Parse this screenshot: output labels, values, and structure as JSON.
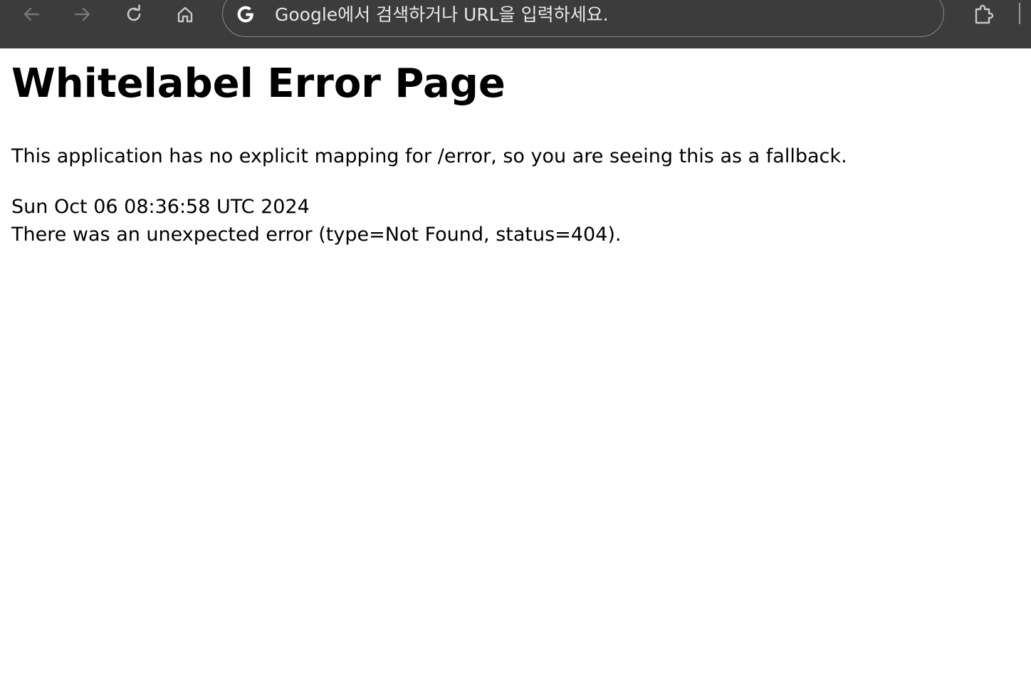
{
  "browser": {
    "omnibox_placeholder": "Google에서 검색하거나 URL을 입력하세요.",
    "icons": [
      "back-arrow-icon",
      "forward-arrow-icon",
      "reload-icon",
      "home-icon",
      "google-g-icon",
      "extensions-icon"
    ],
    "colors": {
      "toolbar": "#3c3c3c",
      "icon": "#c7c7c7",
      "icon_disabled": "#777777",
      "omnibox_text": "#e8e8e8"
    }
  },
  "page": {
    "title": "Whitelabel Error Page",
    "message": "This application has no explicit mapping for /error, so you are seeing this as a fallback.",
    "timestamp": "Sun Oct 06 08:36:58 UTC 2024",
    "error_detail": "There was an unexpected error (type=Not Found, status=404)."
  }
}
